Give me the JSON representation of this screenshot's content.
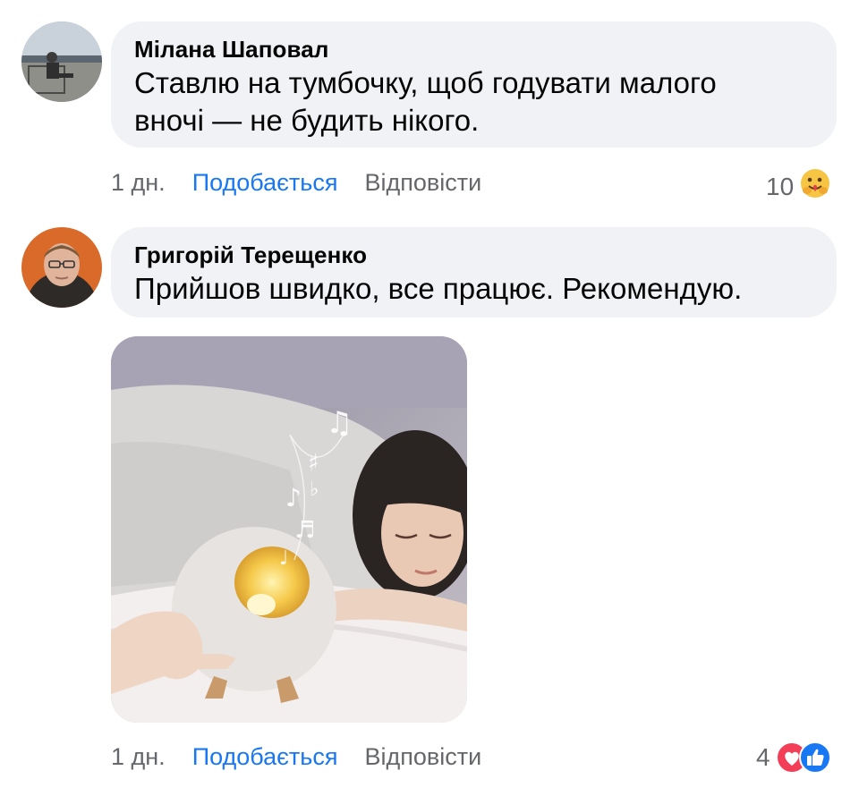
{
  "comments": [
    {
      "author": "Мілана Шаповал",
      "text": "Ставлю на тумбочку, щоб годувати малого вночі — не будить нікого.",
      "time": "1 дн.",
      "like_label": "Подобається",
      "reply_label": "Відповісти",
      "reaction_count": "10",
      "reaction_icons": [
        "hug-emoji-icon"
      ]
    },
    {
      "author": "Григорій Терещенко",
      "text": "Прийшов швидко, все працює. Рекомендую.",
      "time": "1 дн.",
      "like_label": "Подобається",
      "reply_label": "Відповісти",
      "reaction_count": "4",
      "reaction_icons": [
        "love-heart-icon",
        "like-thumb-icon"
      ],
      "attachment": "photo"
    }
  ],
  "colors": {
    "bubble": "#f0f2f5",
    "link": "#1877f2",
    "meta": "#65676b",
    "text": "#050505"
  }
}
